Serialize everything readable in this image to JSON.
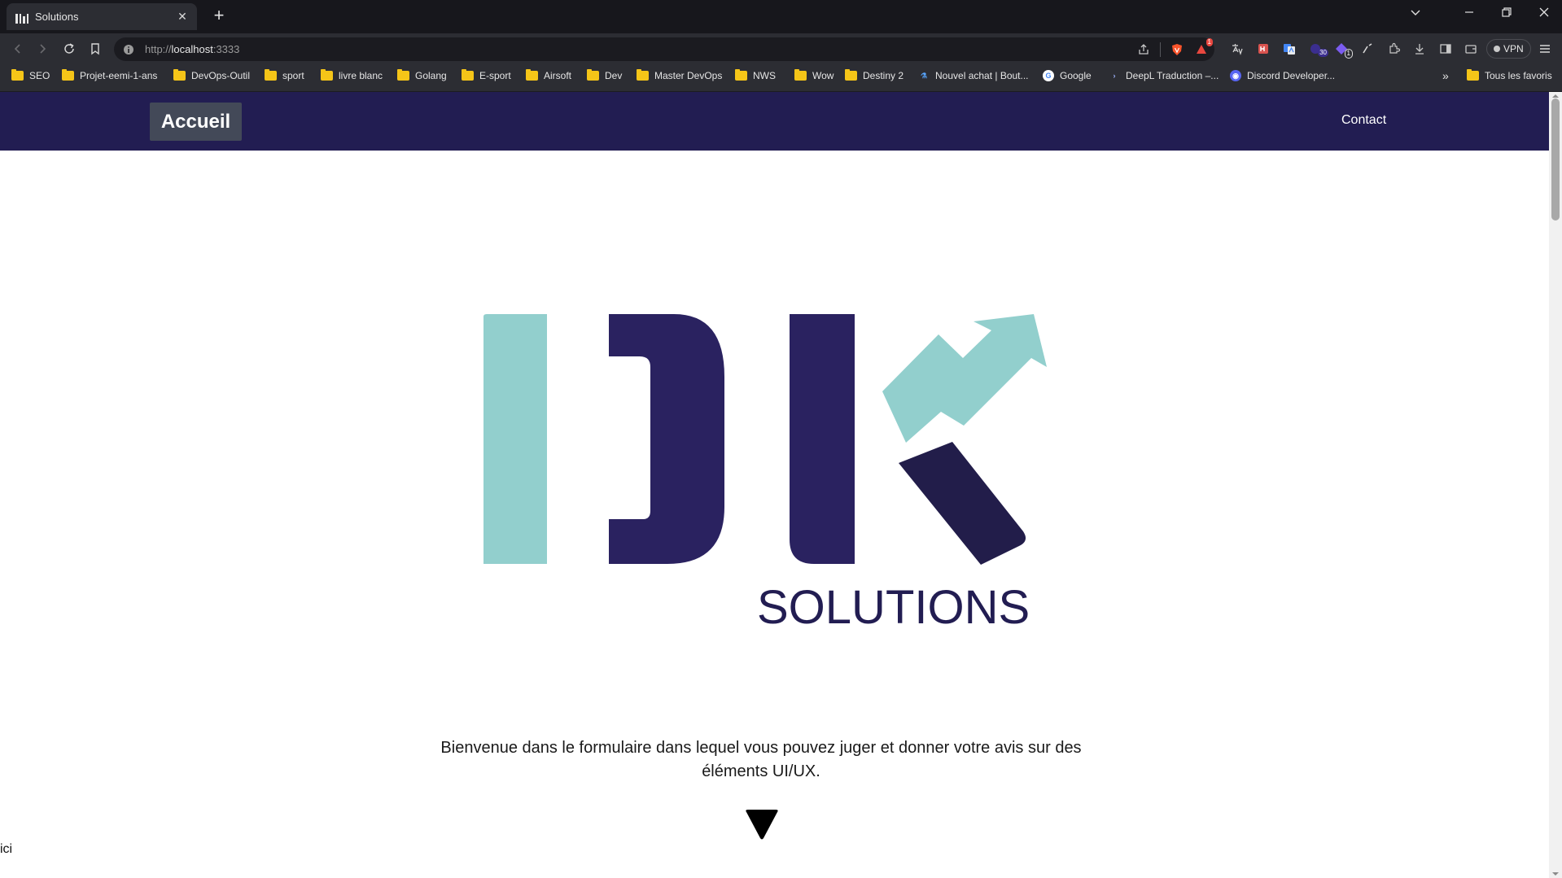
{
  "browser": {
    "tab_title": "Solutions",
    "url": {
      "protocol": "http://",
      "host": "localhost",
      "port": ":3333"
    },
    "vpn_label": "VPN",
    "extension_badges": {
      "brave_rewards": "1",
      "calendar": "30",
      "notes": "1"
    },
    "bookmarks": [
      {
        "label": "SEO",
        "icon": "folder-icon"
      },
      {
        "label": "Projet-eemi-1-ans",
        "icon": "folder-icon"
      },
      {
        "label": "DevOps-Outil",
        "icon": "folder-icon"
      },
      {
        "label": "sport",
        "icon": "folder-icon"
      },
      {
        "label": "livre blanc",
        "icon": "folder-icon"
      },
      {
        "label": "Golang",
        "icon": "folder-icon"
      },
      {
        "label": "E-sport",
        "icon": "folder-icon"
      },
      {
        "label": "Airsoft",
        "icon": "folder-icon"
      },
      {
        "label": "Dev",
        "icon": "folder-icon"
      },
      {
        "label": "Master DevOps",
        "icon": "folder-icon"
      },
      {
        "label": "NWS",
        "icon": "folder-icon"
      },
      {
        "label": "Wow",
        "icon": "folder-icon"
      },
      {
        "label": "Destiny 2",
        "icon": "folder-icon"
      },
      {
        "label": "Nouvel achat | Bout...",
        "icon": "flask-icon"
      },
      {
        "label": "Google",
        "icon": "google-icon"
      },
      {
        "label": "DeepL Traduction –...",
        "icon": "deepl-icon"
      },
      {
        "label": "Discord Developer...",
        "icon": "discord-icon"
      }
    ],
    "other_bookmarks": "Tous les favoris",
    "overflow_label": "»"
  },
  "site": {
    "nav": {
      "home_label": "Accueil",
      "contact_label": "Contact"
    },
    "logo": {
      "wordmark": "SOLUTIONS",
      "teal": "#92cfcd",
      "navy": "#2a2260"
    },
    "intro_text": "Bienvenue dans le formulaire dans lequel vous pouvez juger et donner votre avis sur des éléments UI/UX.",
    "stray_text": "ici"
  },
  "colors": {
    "nav_bg": "#221d52",
    "home_btn_bg": "#434958"
  }
}
